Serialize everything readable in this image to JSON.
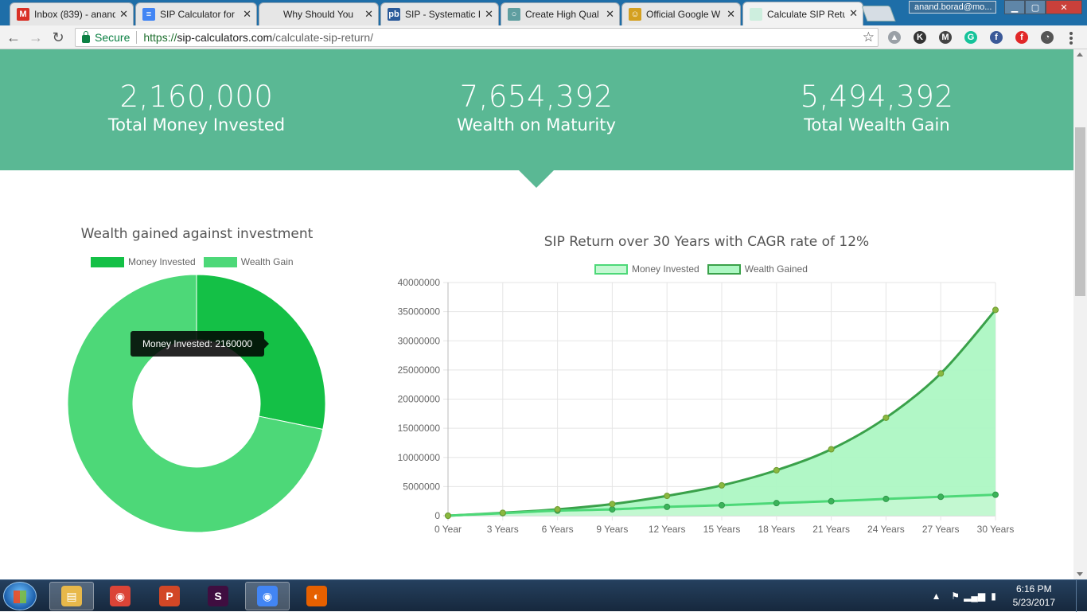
{
  "browser": {
    "tabs": [
      {
        "title": "Inbox (839) - anand",
        "icon": "gmail-icon",
        "glyph": "M",
        "color": "#d93025"
      },
      {
        "title": "SIP Calculator for",
        "icon": "docs-icon",
        "glyph": "≡",
        "color": "#4285f4"
      },
      {
        "title": "Why Should You",
        "icon": "blank-page-icon",
        "glyph": "",
        "color": "#e6e6e6"
      },
      {
        "title": "SIP - Systematic I",
        "icon": "pb-icon",
        "glyph": "pb",
        "color": "#2a5a9a"
      },
      {
        "title": "Create High Qual",
        "icon": "chrome-store-icon",
        "glyph": "○",
        "color": "#5f9ea0"
      },
      {
        "title": "Official Google W",
        "icon": "blogger-icon",
        "glyph": "☺",
        "color": "#d4a020"
      },
      {
        "title": "Calculate SIP Retu",
        "icon": "site-favicon",
        "glyph": "",
        "color": "#cdeede"
      }
    ],
    "profile": "anand.borad@mo...",
    "address": {
      "secure_label": "Secure",
      "scheme": "https://",
      "host": "sip-calculators.com",
      "path": "/calculate-sip-return/"
    },
    "extensions": [
      {
        "name": "drive-icon",
        "glyph": "▲",
        "color": "#9aa0a6"
      },
      {
        "name": "k-extension-icon",
        "glyph": "K",
        "color": "#333333"
      },
      {
        "name": "gmail-ext-icon",
        "glyph": "M",
        "color": "#444444"
      },
      {
        "name": "grammarly-icon",
        "glyph": "G",
        "color": "#15c39a"
      },
      {
        "name": "facebook-icon",
        "glyph": "f",
        "color": "#3b5998"
      },
      {
        "name": "flipboard-icon",
        "glyph": "f",
        "color": "#e12828"
      },
      {
        "name": "speed-icon",
        "glyph": "◔",
        "color": "#555555"
      }
    ]
  },
  "summary": {
    "invested_value": "2,160,000",
    "invested_label": "Total Money Invested",
    "maturity_value": "7,654,392",
    "maturity_label": "Wealth on Maturity",
    "gain_value": "5,494,392",
    "gain_label": "Total Wealth Gain",
    "band_color": "#5ab894"
  },
  "tooltip": "Money Invested: 2160000",
  "chart_data": [
    {
      "type": "pie",
      "title": "Wealth gained against investment",
      "labels": [
        "Money Invested",
        "Wealth Gain"
      ],
      "values": [
        2160000,
        5494392
      ],
      "colors": [
        "#14c046",
        "#4dd878"
      ]
    },
    {
      "type": "area",
      "title": "SIP Return over 30 Years with CAGR rate of 12%",
      "x": [
        "0 Year",
        "3 Years",
        "6 Years",
        "9 Years",
        "12 Years",
        "15 Years",
        "18 Years",
        "21 Years",
        "24 Years",
        "27 Years",
        "30 Years"
      ],
      "series": [
        {
          "name": "Money Invested",
          "values": [
            0,
            432000,
            864000,
            1080000,
            1512000,
            1800000,
            2160000,
            2484000,
            2880000,
            3240000,
            3600000
          ],
          "line": "#4dd878",
          "fill": "#c4f8d2"
        },
        {
          "name": "Wealth Gained",
          "values": [
            0,
            500000,
            1100000,
            2000000,
            3400000,
            5200000,
            7800000,
            11400000,
            16800000,
            24400000,
            35300000
          ],
          "line": "#3aa14a",
          "fill": "#adf7c3"
        }
      ],
      "ylim": [
        0,
        40000000
      ],
      "yticks": [
        0,
        5000000,
        10000000,
        15000000,
        20000000,
        25000000,
        30000000,
        35000000,
        40000000
      ],
      "grid": true,
      "legend": "top"
    }
  ],
  "taskbar": {
    "apps": [
      {
        "name": "file-explorer-icon",
        "glyph": "▤",
        "color": "#e8b84a"
      },
      {
        "name": "chrome-icon",
        "glyph": "◉",
        "color": "#db4437"
      },
      {
        "name": "powerpoint-icon",
        "glyph": "P",
        "color": "#d24726"
      },
      {
        "name": "slack-icon",
        "glyph": "S",
        "color": "#3f0e40"
      },
      {
        "name": "chrome-profile-icon",
        "glyph": "◉",
        "color": "#4285f4"
      },
      {
        "name": "firefox-icon",
        "glyph": "◐",
        "color": "#e66000"
      }
    ],
    "time": "6:16 PM",
    "date": "5/23/2017"
  }
}
